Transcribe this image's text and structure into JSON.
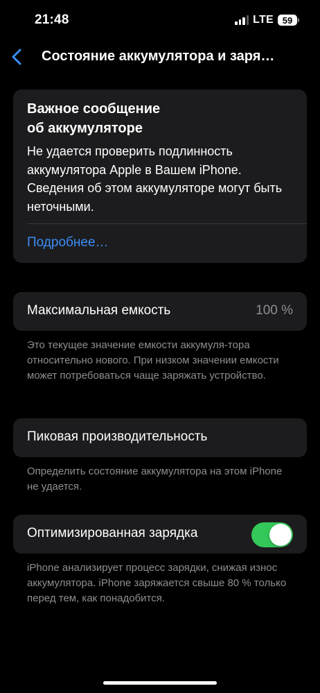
{
  "status_bar": {
    "time": "21:48",
    "network": "LTE",
    "battery_level": "59"
  },
  "nav": {
    "title": "Состояние аккумулятора и заря…",
    "back_icon": "chevron-left-icon"
  },
  "message_card": {
    "title": "Важное сообщение\nоб аккумуляторе",
    "body": "Не удается проверить подлинность аккумулятора Apple в Вашем iPhone. Сведения об этом аккумуляторе могут быть неточными.",
    "link": "Подробнее…"
  },
  "capacity": {
    "label": "Максимальная емкость",
    "value": "100 %",
    "footnote": "Это текущее значение емкости аккумуля-тора относительно нового. При низком значении емкости может потребоваться чаще заряжать устройство."
  },
  "peak": {
    "label": "Пиковая производительность",
    "footnote": "Определить состояние аккумулятора на этом iPhone не удается."
  },
  "charging": {
    "label": "Оптимизированная зарядка",
    "toggle_on": true,
    "footnote": "iPhone анализирует процесс зарядки, снижая износ аккумулятора. iPhone заряжается свыше 80 % только перед тем, как понадобится."
  },
  "colors": {
    "accent": "#3b8cf5",
    "toggle_on": "#34c759",
    "card_bg": "#1c1c1e",
    "secondary_text": "#8e8e93"
  }
}
